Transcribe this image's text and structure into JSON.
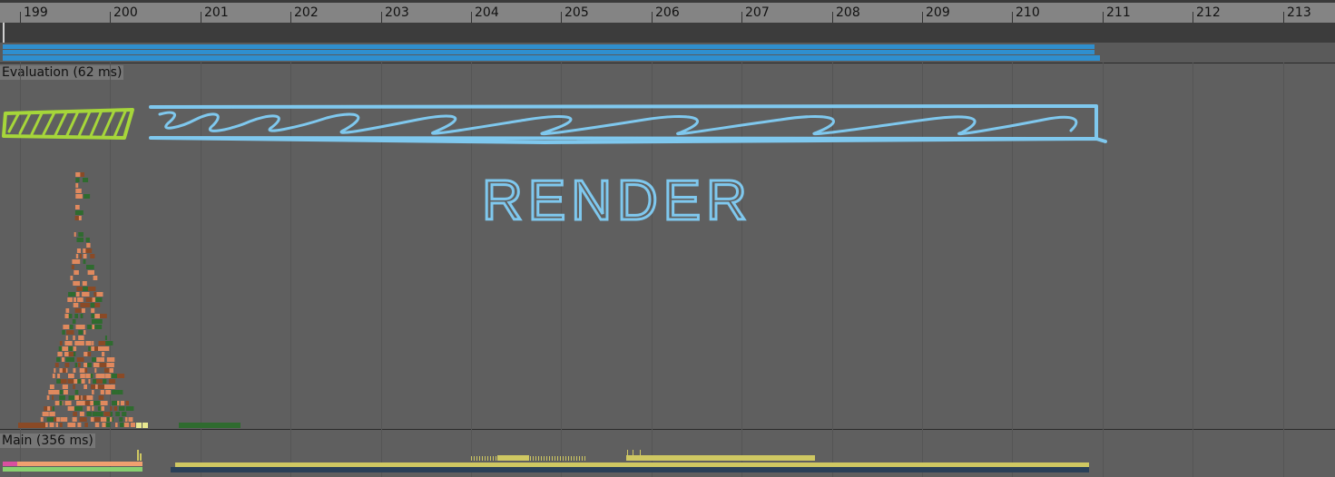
{
  "ruler": {
    "ticks": [
      "199",
      "200",
      "201",
      "202",
      "203",
      "204",
      "205",
      "206",
      "207",
      "208",
      "209",
      "210",
      "211",
      "212",
      "213"
    ]
  },
  "sections": {
    "evaluation_label": "Evaluation (62 ms)",
    "main_label": "Main (356 ms)"
  },
  "annotation": {
    "text": "RENDER",
    "color": "#7fc8ee",
    "eval_color": "#a6d63a"
  },
  "colors": {
    "frame_bar": "#2f8fcf",
    "task_salmon": "#e0895e",
    "task_brown": "#8a4a26",
    "task_green": "#2f6b2f",
    "main_yellow": "#cfc862",
    "main_pink": "#d94fa0",
    "main_peach": "#f0a070",
    "main_green": "#88d070",
    "main_navy": "#2a4058"
  }
}
